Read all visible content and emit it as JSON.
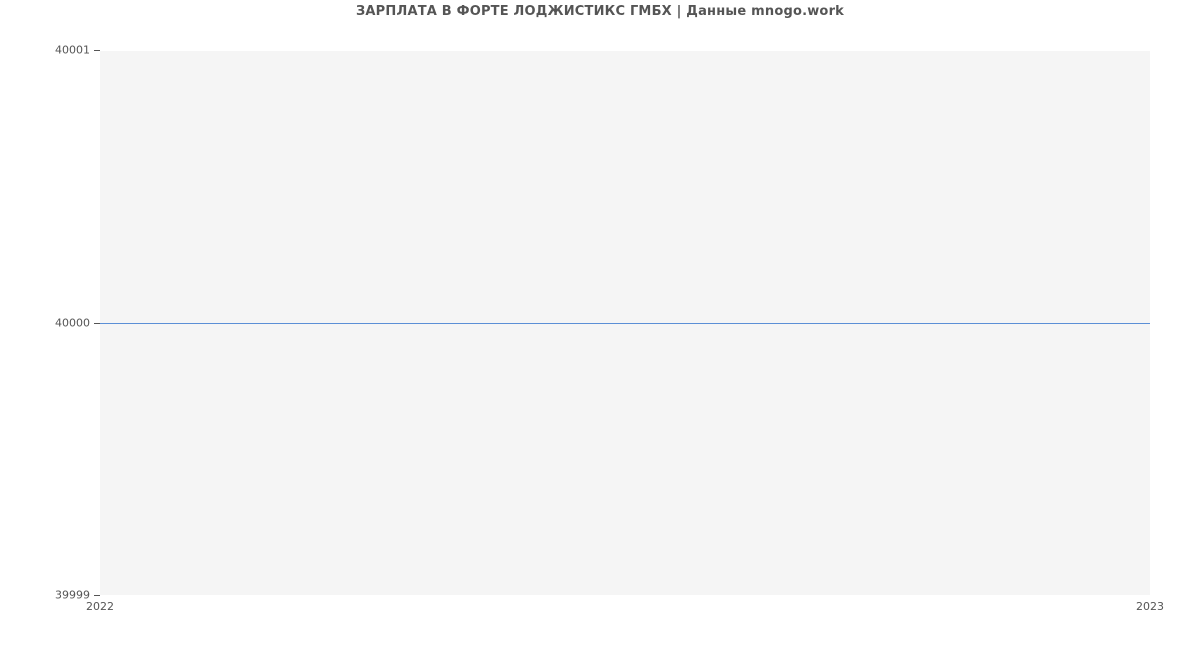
{
  "chart_data": {
    "type": "line",
    "title": "ЗАРПЛАТА В ФОРТЕ ЛОДЖИСТИКС ГМБХ | Данные mnogo.work",
    "x": [
      "2022",
      "2023"
    ],
    "values": [
      40000,
      40000
    ],
    "xlabel": "",
    "ylabel": "",
    "ylim": [
      39999,
      40001
    ],
    "xlim": [
      "2022",
      "2023"
    ],
    "y_ticks": [
      39999,
      40000,
      40001
    ],
    "x_ticks": [
      "2022",
      "2023"
    ],
    "line_color": "#5b8fd6",
    "background": "#f5f5f5"
  }
}
